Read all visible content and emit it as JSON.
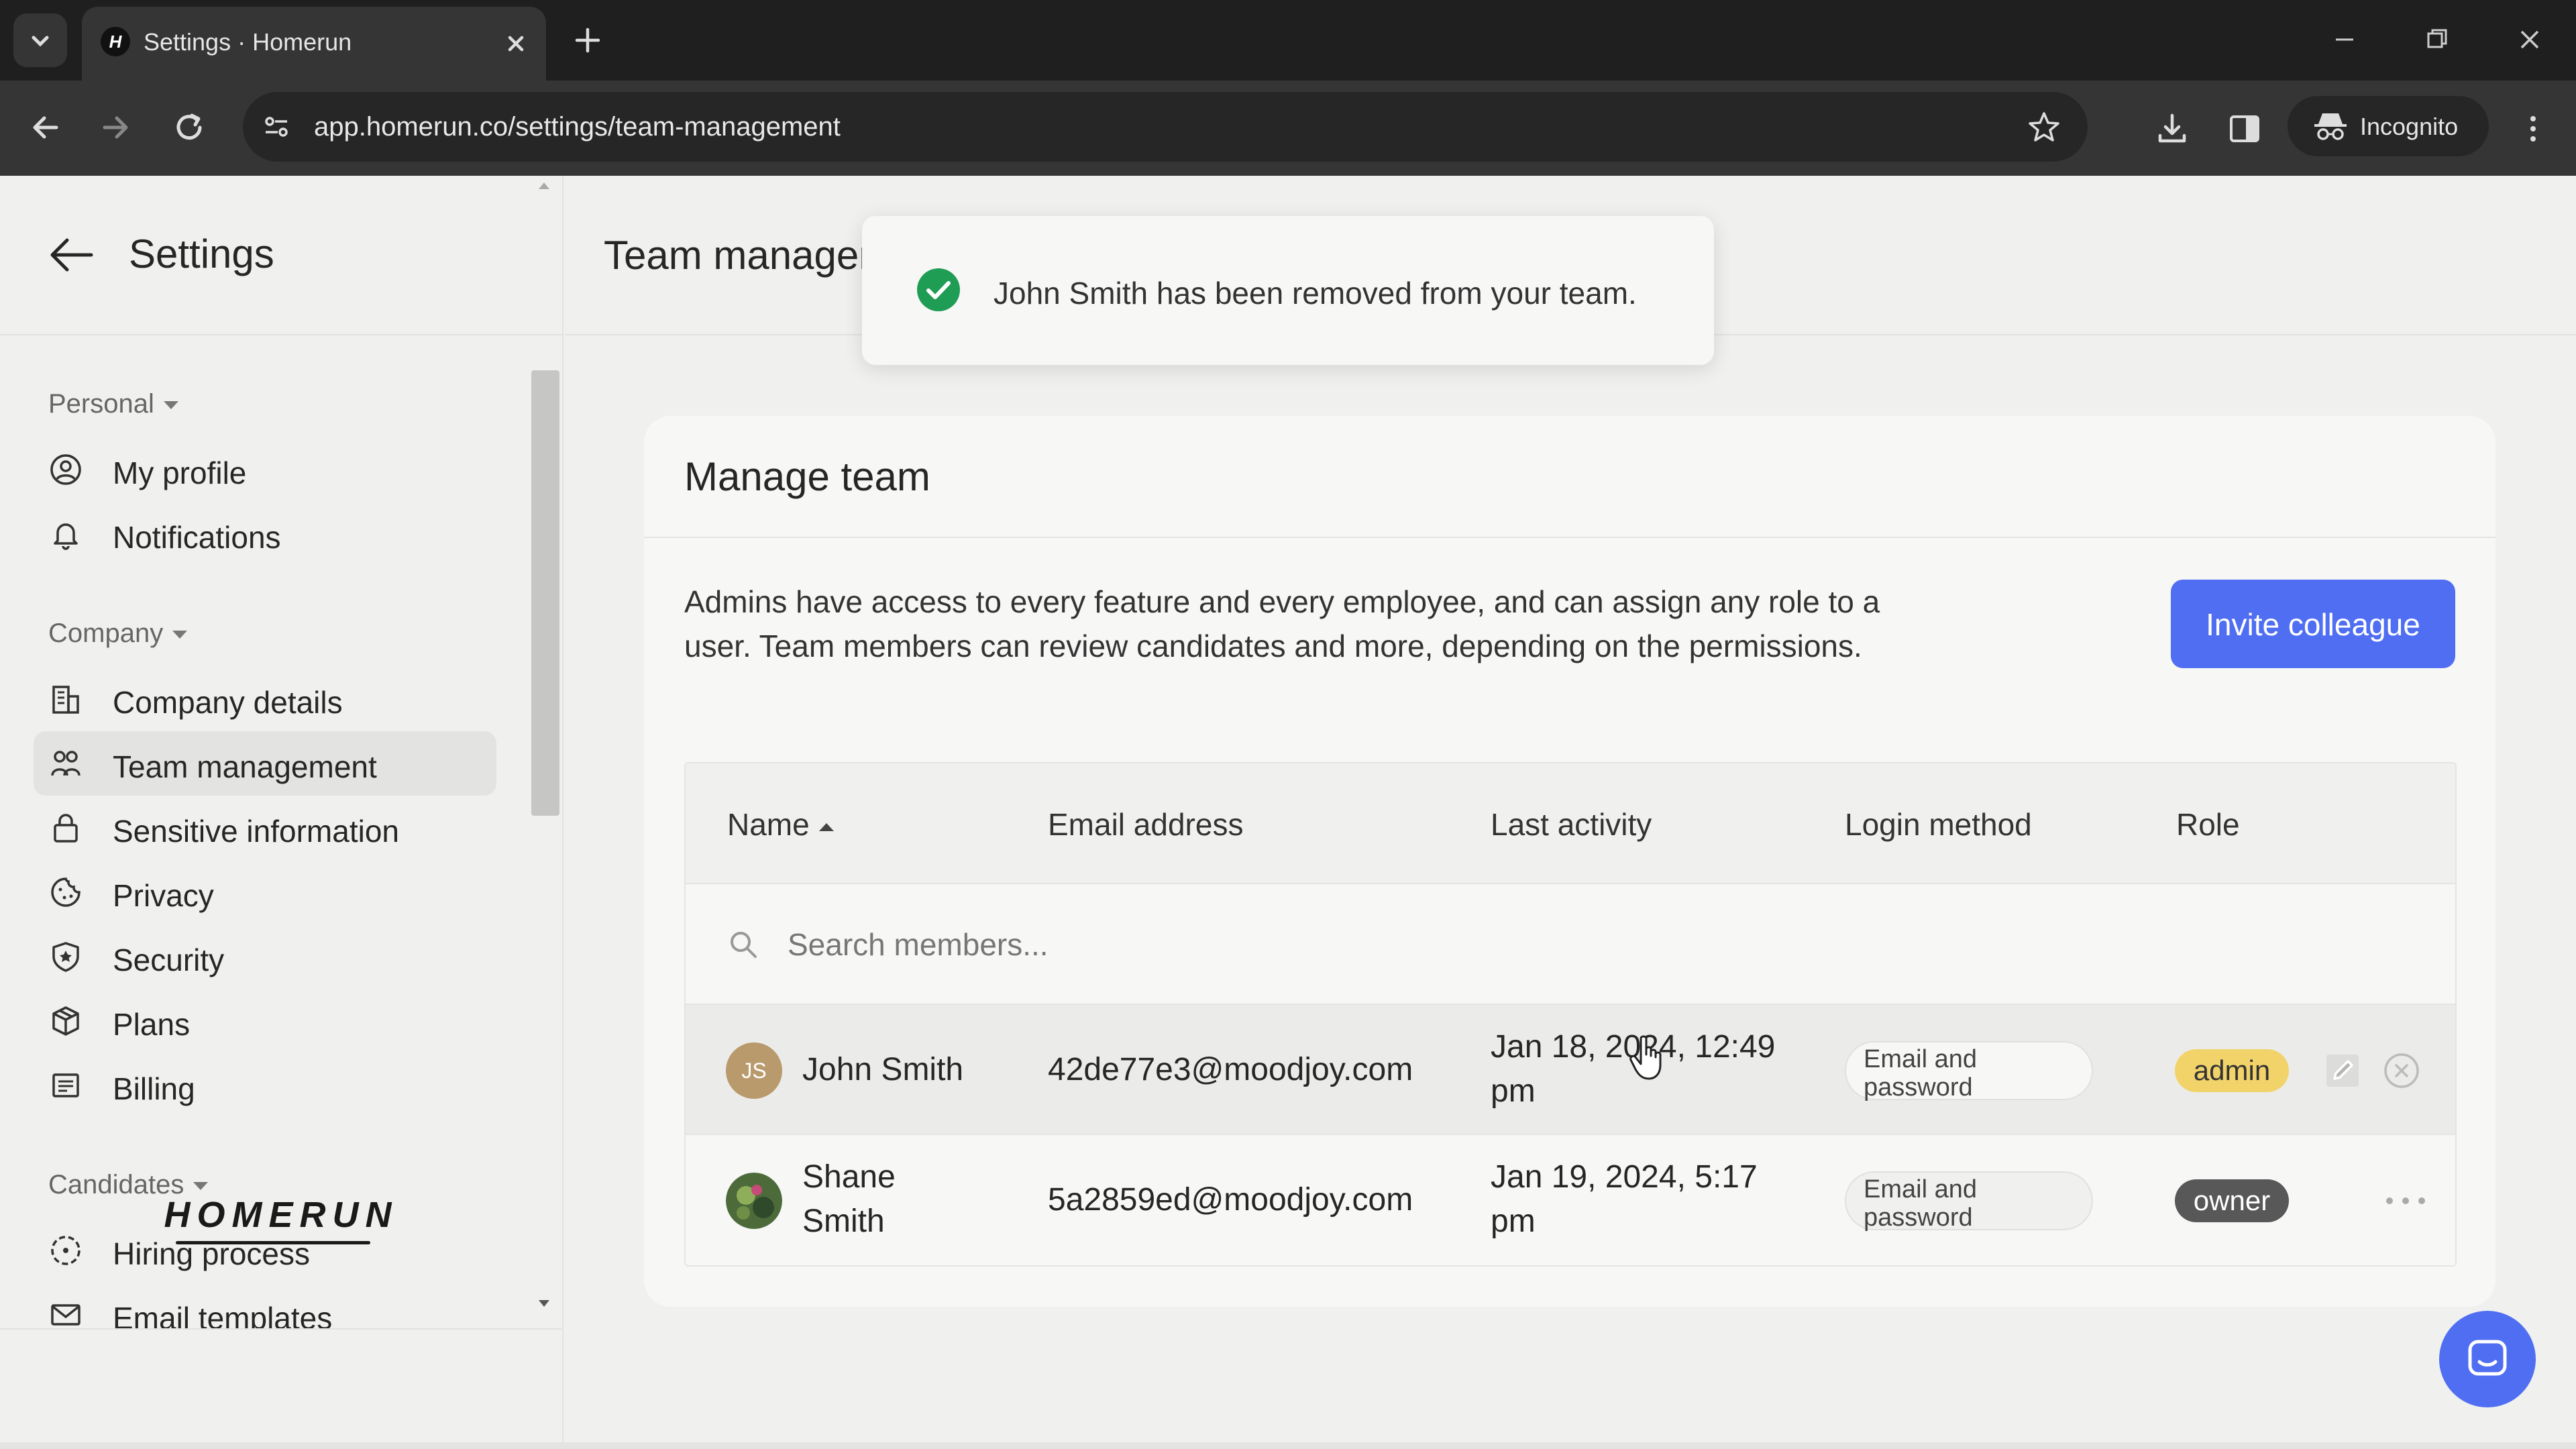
{
  "browser": {
    "tab_title": "Settings · Homerun",
    "favicon_letter": "H",
    "url": "app.homerun.co/settings/team-management",
    "incognito_label": "Incognito"
  },
  "sidebar": {
    "back_icon": "arrow-left-icon",
    "title": "Settings",
    "sections": [
      {
        "label": "Personal",
        "items": [
          {
            "label": "My profile",
            "icon": "user-circle-icon"
          },
          {
            "label": "Notifications",
            "icon": "bell-icon"
          }
        ]
      },
      {
        "label": "Company",
        "items": [
          {
            "label": "Company details",
            "icon": "building-icon"
          },
          {
            "label": "Team management",
            "icon": "users-icon",
            "active": true
          },
          {
            "label": "Sensitive information",
            "icon": "lock-icon"
          },
          {
            "label": "Privacy",
            "icon": "cookie-icon"
          },
          {
            "label": "Security",
            "icon": "shield-star-icon"
          },
          {
            "label": "Plans",
            "icon": "box-icon"
          },
          {
            "label": "Billing",
            "icon": "receipt-icon"
          }
        ]
      },
      {
        "label": "Candidates",
        "items": [
          {
            "label": "Hiring process",
            "icon": "circle-dashed-icon"
          },
          {
            "label": "Email templates",
            "icon": "envelope-icon"
          }
        ]
      }
    ],
    "logo_text": "HOMERUN"
  },
  "main": {
    "page_title": "Team manager",
    "toast": {
      "message": "John Smith has been removed from your team.",
      "status_color": "#1f9d55"
    },
    "card": {
      "title": "Manage team",
      "description": "Admins have access to every feature and every employee, and can assign any role to a user. Team members can review candidates and more, depending on the permissions.",
      "invite_label": "Invite colleague",
      "accent_color": "#4f6ef2"
    },
    "table": {
      "columns": {
        "name": "Name",
        "email": "Email address",
        "last_activity": "Last activity",
        "login_method": "Login method",
        "role": "Role"
      },
      "search_placeholder": "Search members...",
      "rows": [
        {
          "initials": "JS",
          "name": "John Smith",
          "email": "42de77e3@moodjoy.com",
          "last_activity_line1": "Jan 18, 2024, 12:49",
          "last_activity_line2": "pm",
          "login_line1": "Email and",
          "login_line2": "password",
          "role": "admin"
        },
        {
          "initials": "",
          "name_line1": "Shane",
          "name_line2": "Smith",
          "email": "5a2859ed@moodjoy.com",
          "last_activity_line1": "Jan 19, 2024, 5:17",
          "last_activity_line2": "pm",
          "login_line1": "Email and",
          "login_line2": "password",
          "role": "owner"
        }
      ]
    }
  }
}
